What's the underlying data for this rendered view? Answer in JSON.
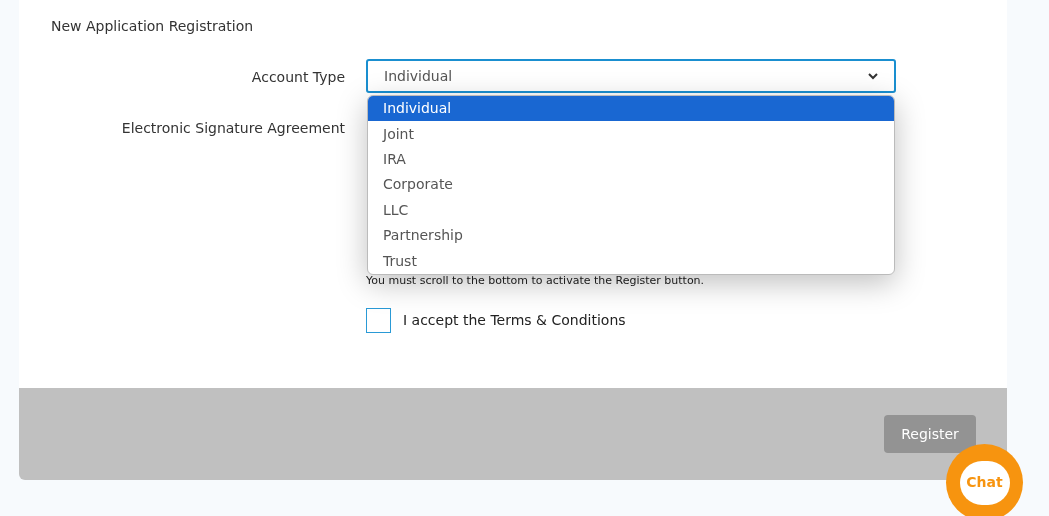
{
  "title": "New Application Registration",
  "account_type": {
    "label": "Account Type",
    "value": "Individual",
    "expanded": true,
    "options": [
      {
        "label": "Individual",
        "selected": true
      },
      {
        "label": "Joint",
        "selected": false
      },
      {
        "label": "IRA",
        "selected": false
      },
      {
        "label": "Corporate",
        "selected": false
      },
      {
        "label": "LLC",
        "selected": false
      },
      {
        "label": "Partnership",
        "selected": false
      },
      {
        "label": "Trust",
        "selected": false
      }
    ]
  },
  "signature": {
    "label": "Electronic Signature Agreement",
    "note": "You must scroll to the bottom to activate the Register button."
  },
  "terms": {
    "label": "I accept the Terms & Conditions",
    "checked": false
  },
  "register": {
    "label": "Register",
    "disabled": true
  },
  "chat": {
    "label": "Chat"
  }
}
